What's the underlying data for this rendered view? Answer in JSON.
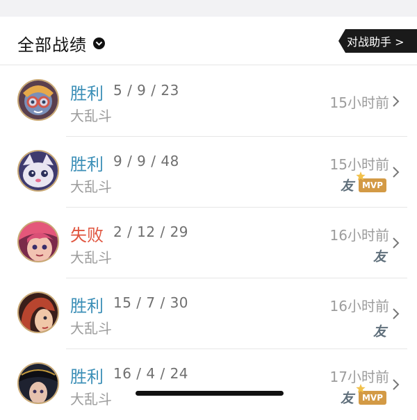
{
  "header": {
    "title": "全部战绩",
    "assistant_button": "对战助手 >"
  },
  "matches": [
    {
      "result": "胜利",
      "outcome": "win",
      "kda": "5 / 9 / 23",
      "mode": "大乱斗",
      "time": "15小时前",
      "friend_badge": "",
      "mvp": ""
    },
    {
      "result": "胜利",
      "outcome": "win",
      "kda": "9 / 9 / 48",
      "mode": "大乱斗",
      "time": "15小时前",
      "friend_badge": "友",
      "mvp": "MVP"
    },
    {
      "result": "失败",
      "outcome": "lose",
      "kda": "2 / 12 / 29",
      "mode": "大乱斗",
      "time": "16小时前",
      "friend_badge": "友",
      "mvp": ""
    },
    {
      "result": "胜利",
      "outcome": "win",
      "kda": "15 / 7 / 30",
      "mode": "大乱斗",
      "time": "16小时前",
      "friend_badge": "友",
      "mvp": ""
    },
    {
      "result": "胜利",
      "outcome": "win",
      "kda": "16 / 4 / 24",
      "mode": "大乱斗",
      "time": "17小时前",
      "friend_badge": "友",
      "mvp": "MVP"
    }
  ],
  "colors": {
    "win": "#3c8fb7",
    "lose": "#e0553f",
    "mvp": "#d39a45",
    "avatar_ring": "#c9a873"
  }
}
